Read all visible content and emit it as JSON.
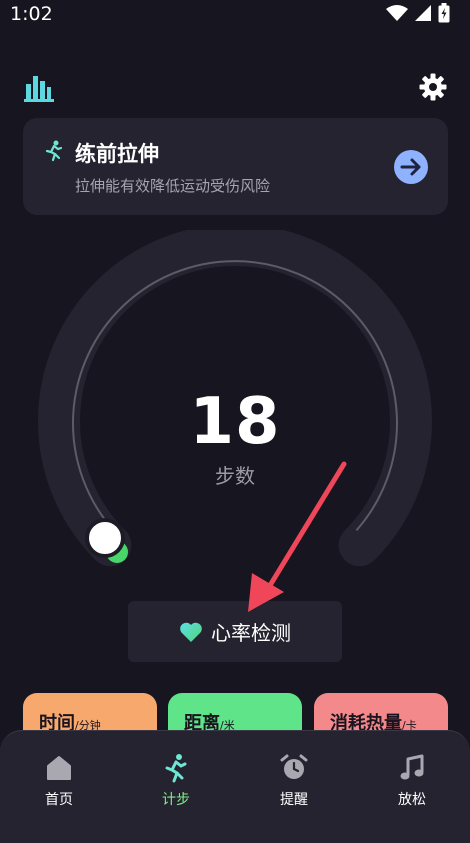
{
  "status_bar": {
    "time": "1:02"
  },
  "stretch_card": {
    "title": "练前拉伸",
    "subtitle": "拉伸能有效降低运动受伤风险"
  },
  "steps": {
    "count": "18",
    "label": "步数"
  },
  "heart_button": {
    "label": "心率检测"
  },
  "metrics": [
    {
      "title": "时间",
      "unit": "/分钟",
      "color": "#f7a86c"
    },
    {
      "title": "距离",
      "unit": "/米",
      "color": "#5fe489"
    },
    {
      "title": "消耗热量",
      "unit": "/卡",
      "color": "#f3898a"
    }
  ],
  "nav": [
    {
      "label": "首页",
      "icon": "home-icon"
    },
    {
      "label": "计步",
      "icon": "running-icon",
      "active": true
    },
    {
      "label": "提醒",
      "icon": "alarm-clock-icon"
    },
    {
      "label": "放松",
      "icon": "music-note-icon"
    }
  ],
  "colors": {
    "background": "#17151f",
    "card": "#25232f",
    "accent_green": "#7ff08a",
    "arrow_blue": "#8fb2ff",
    "pointer_red": "#f0465a"
  }
}
